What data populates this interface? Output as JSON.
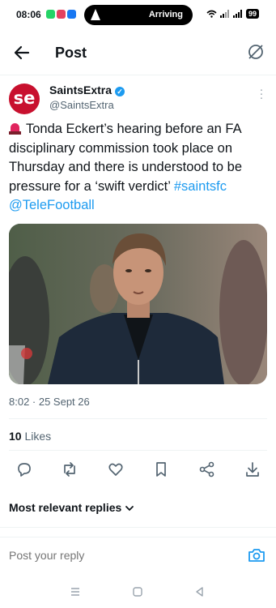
{
  "status": {
    "time": "08:06",
    "arriving": "Arriving",
    "battery": "99",
    "app_colors": [
      "#25d366",
      "#e4405f",
      "#1877f2"
    ]
  },
  "header": {
    "title": "Post"
  },
  "author": {
    "name": "SaintsExtra",
    "handle": "@SaintsExtra",
    "avatar_text": "se",
    "avatar_color": "#c8102e"
  },
  "tweet": {
    "text_main": "Tonda Eckert’s hearing before an FA disciplinary commission took place on Thursday and there is understood to be pressure for a ‘swift verdict’ ",
    "hashtag": "#saintsfc",
    "mention": "@TeleFootball"
  },
  "meta": {
    "timestamp": "8:02 · 25 Sept 26"
  },
  "engagement": {
    "likes_count": "10",
    "likes_label": " Likes"
  },
  "replies": {
    "sort_label": "Most relevant replies"
  },
  "reply_bar": {
    "placeholder": "Post your reply"
  },
  "icons": [
    "back-arrow-icon",
    "sync-icon",
    "verified-icon",
    "more-icon",
    "siren-icon",
    "reply-icon",
    "repost-icon",
    "like-icon",
    "bookmark-icon",
    "share-icon",
    "download-icon",
    "chevron-down-icon",
    "camera-icon",
    "recent-apps-icon",
    "home-icon",
    "back-nav-icon"
  ],
  "colors": {
    "link": "#1d9bf0",
    "muted": "#536471",
    "text": "#0f1419"
  }
}
